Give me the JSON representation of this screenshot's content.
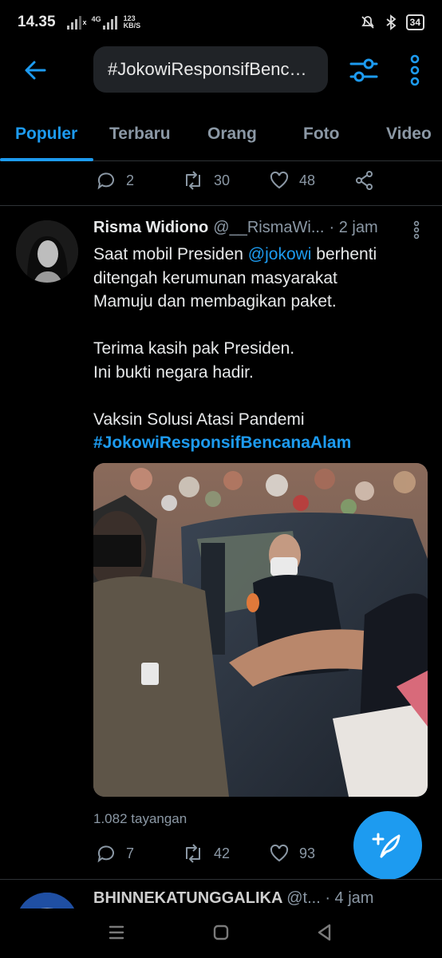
{
  "status": {
    "time": "14.35",
    "net_x": "x",
    "net_4g": "4G",
    "net_speed_value": "123",
    "net_speed_unit": "KB/S",
    "battery": "34"
  },
  "header": {
    "search_query": "#JokowiResponsifBenc…",
    "back_icon": "arrow-left-icon",
    "filter_icon": "sliders-icon",
    "more_icon": "vertical-dots-icon"
  },
  "tabs": [
    {
      "label": "Populer",
      "active": true
    },
    {
      "label": "Terbaru",
      "active": false
    },
    {
      "label": "Orang",
      "active": false
    },
    {
      "label": "Foto",
      "active": false
    },
    {
      "label": "Video",
      "active": false
    }
  ],
  "prev_tweet": {
    "replies": "2",
    "retweets": "30",
    "likes": "48"
  },
  "tweet": {
    "name": "Risma Widiono",
    "handle": "@__RismaWi...",
    "time": "· 2 jam",
    "line1_pre": "Saat mobil Presiden ",
    "mention": "@jokowi",
    "line1_post": " berhenti",
    "line2": "ditengah kerumunan masyarakat",
    "line3": "Mamuju dan membagikan paket.",
    "line4": "Terima kasih pak Presiden.",
    "line5": "Ini bukti negara hadir.",
    "line6": "Vaksin Solusi Atasi Pandemi",
    "hashtag": "#JokowiResponsifBencanaAlam",
    "views": "1.082 tayangan",
    "replies": "7",
    "retweets": "42",
    "likes": "93"
  },
  "next_tweet": {
    "name": "BHINNEKATUNGGALIKA",
    "handle": "@t...",
    "time": "· 4 jam"
  },
  "colors": {
    "accent": "#1d9bf0",
    "background": "#000000",
    "muted": "#8b98a5"
  }
}
